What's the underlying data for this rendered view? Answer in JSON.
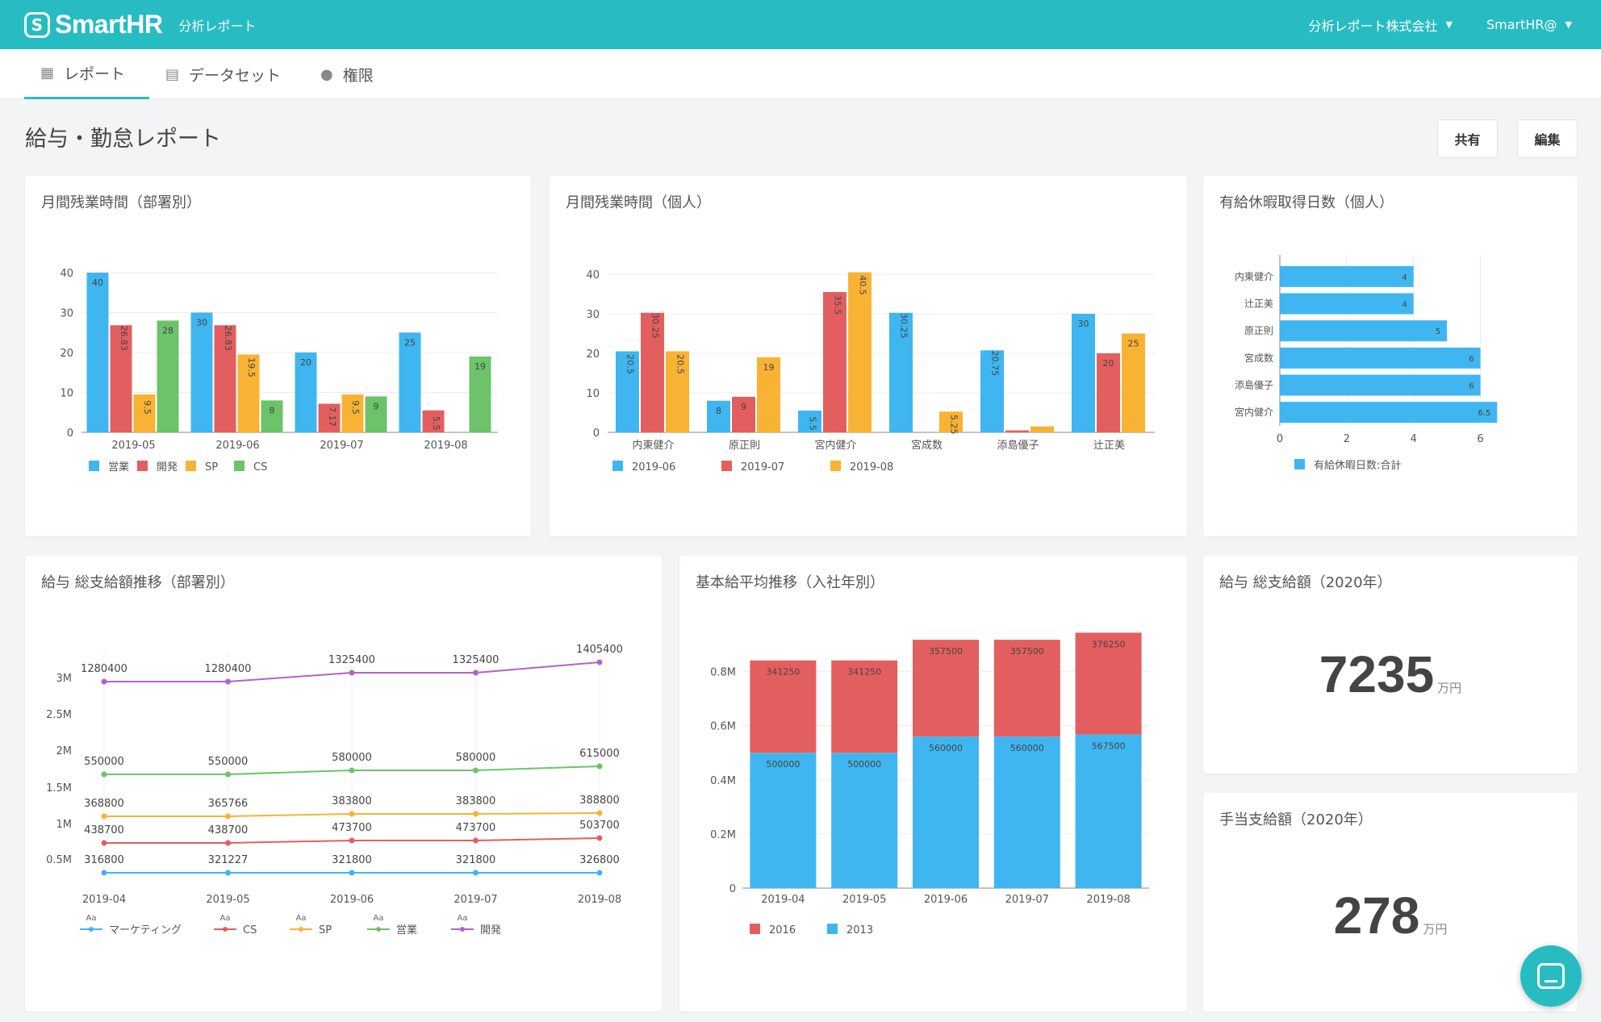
{
  "header": {
    "logo_mark": "S",
    "logo_text": "SmartHR",
    "subtitle": "分析レポート",
    "company_menu": "分析レポート株式会社",
    "user_menu": "SmartHR@"
  },
  "nav": {
    "tabs": [
      {
        "label": "レポート",
        "icon": "report-icon",
        "active": true
      },
      {
        "label": "データセット",
        "icon": "dataset-icon",
        "active": false
      },
      {
        "label": "権限",
        "icon": "user-icon",
        "active": false
      }
    ]
  },
  "page": {
    "title": "給与・勤怠レポート",
    "share_button": "共有",
    "edit_button": "編集"
  },
  "colors": {
    "accent": "#27bcc2",
    "blue": "#3fb6f0",
    "red": "#e35f5f",
    "orange": "#f8b334",
    "green": "#6cc36a",
    "purple": "#b163c9"
  },
  "cards": {
    "dept_overtime": "月間残業時間（部署別）",
    "person_overtime": "月間残業時間（個人）",
    "paid_leave": "有給休暇取得日数（個人）",
    "salary_trend": "給与 総支給額推移（部署別）",
    "base_salary": "基本給平均推移（入社年別）",
    "salary_total": "給与 総支給額（2020年）",
    "allowance_total": "手当支給額（2020年）"
  },
  "kpis": {
    "salary_total": {
      "value": "7235",
      "unit": "万円"
    },
    "allowance_total": {
      "value": "278",
      "unit": "万円"
    }
  },
  "chart_data": [
    {
      "id": "dept_overtime",
      "type": "bar",
      "categories": [
        "2019-05",
        "2019-06",
        "2019-07",
        "2019-08"
      ],
      "series": [
        {
          "name": "営業",
          "color": "#3fb6f0",
          "values": [
            40,
            30,
            20,
            25
          ],
          "labels": [
            "40",
            "30",
            "20",
            "25"
          ]
        },
        {
          "name": "開発",
          "color": "#e35f5f",
          "values": [
            26.83,
            26.83,
            7.17,
            5.5
          ],
          "labels": [
            "26.83",
            "26.83",
            "7.17",
            "5.5"
          ]
        },
        {
          "name": "SP",
          "color": "#f8b334",
          "values": [
            9.5,
            19.5,
            9.5,
            0
          ],
          "labels": [
            "9.5",
            "19.5",
            "9.5",
            ""
          ]
        },
        {
          "name": "CS",
          "color": "#6cc36a",
          "values": [
            28,
            8,
            9,
            19
          ],
          "labels": [
            "28",
            "8",
            "9",
            "19"
          ]
        }
      ],
      "ylim": [
        0,
        40
      ],
      "yticks": [
        0,
        10,
        20,
        30,
        40
      ],
      "grid": true,
      "legend": "bottom"
    },
    {
      "id": "person_overtime",
      "type": "bar",
      "categories": [
        "内東健介",
        "原正則",
        "宮内健介",
        "宮成数",
        "添島優子",
        "辻正美"
      ],
      "series": [
        {
          "name": "2019-06",
          "color": "#3fb6f0",
          "values": [
            20.5,
            8,
            5.5,
            30.25,
            20.75,
            30
          ],
          "labels": [
            "20.5",
            "8",
            "5.5",
            "30.25",
            "20.75",
            "30"
          ]
        },
        {
          "name": "2019-07",
          "color": "#e35f5f",
          "values": [
            30.25,
            9,
            35.5,
            0,
            0.5,
            20
          ],
          "labels": [
            "30.25",
            "9",
            "35.5",
            "",
            "",
            "20"
          ]
        },
        {
          "name": "2019-08",
          "color": "#f8b334",
          "values": [
            20.5,
            19,
            40.5,
            5.25,
            1.5,
            25
          ],
          "labels": [
            "20.5",
            "19",
            "40.5",
            "5.25",
            "",
            "25"
          ]
        }
      ],
      "ylim": [
        0,
        40
      ],
      "yticks": [
        0,
        10,
        20,
        30,
        40
      ],
      "grid": true,
      "legend": "bottom"
    },
    {
      "id": "paid_leave",
      "type": "bar",
      "orientation": "horizontal",
      "categories": [
        "内東健介",
        "辻正美",
        "原正則",
        "宮成数",
        "添島優子",
        "宮内健介"
      ],
      "series": [
        {
          "name": "有給休暇日数:合計",
          "color": "#3fb6f0",
          "values": [
            4,
            4,
            5,
            6,
            6,
            6.5
          ],
          "labels": [
            "4",
            "4",
            "5",
            "6",
            "6",
            "6.5"
          ]
        }
      ],
      "xlim": [
        0,
        7
      ],
      "xticks": [
        0,
        2,
        4,
        6
      ],
      "legend": "bottom"
    },
    {
      "id": "salary_trend",
      "type": "line",
      "x": [
        "2019-04",
        "2019-05",
        "2019-06",
        "2019-07",
        "2019-08"
      ],
      "series": [
        {
          "name": "マーケティング",
          "color": "#3fb6f0",
          "values": [
            316800,
            321227,
            321800,
            321800,
            326800
          ]
        },
        {
          "name": "CS",
          "color": "#e35f5f",
          "values": [
            438700,
            438700,
            473700,
            473700,
            503700
          ]
        },
        {
          "name": "SP",
          "color": "#f8b334",
          "values": [
            368800,
            365766,
            383800,
            383800,
            388800
          ]
        },
        {
          "name": "営業",
          "color": "#6cc36a",
          "values": [
            550000,
            550000,
            580000,
            580000,
            615000
          ]
        },
        {
          "name": "開発",
          "color": "#b163c9",
          "values": [
            1280400,
            1280400,
            1325400,
            1325400,
            1405400
          ]
        }
      ],
      "yticks": [
        "0.5M",
        "1M",
        "1.5M",
        "2M",
        "2.5M",
        "3M"
      ],
      "legend_marker": "Aa",
      "grid": true,
      "legend": "bottom"
    },
    {
      "id": "base_salary",
      "type": "bar",
      "stacked": true,
      "categories": [
        "2019-04",
        "2019-05",
        "2019-06",
        "2019-07",
        "2019-08"
      ],
      "series": [
        {
          "name": "2013",
          "color": "#3fb6f0",
          "values": [
            500000,
            500000,
            560000,
            560000,
            567500
          ]
        },
        {
          "name": "2016",
          "color": "#e35f5f",
          "values": [
            341250,
            341250,
            357500,
            357500,
            376250
          ]
        }
      ],
      "ylim": [
        0,
        0.9
      ],
      "yticks": [
        "0",
        "0.2M",
        "0.4M",
        "0.6M",
        "0.8M"
      ],
      "legend_order": [
        "2016",
        "2013"
      ],
      "legend": "bottom"
    }
  ]
}
